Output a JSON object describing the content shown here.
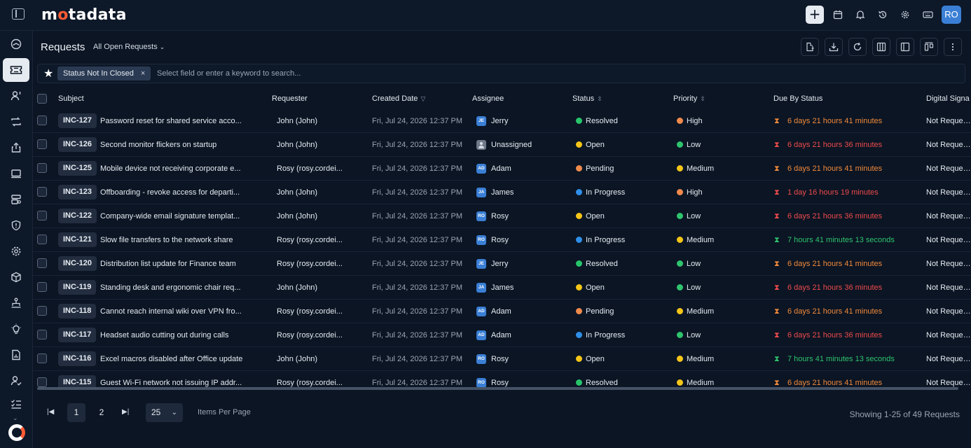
{
  "brand": {
    "logo_pre": "m",
    "logo_dot": "o",
    "logo_post": "tadata"
  },
  "topbar": {
    "avatar": "RO"
  },
  "header": {
    "title": "Requests",
    "view": "All Open Requests"
  },
  "filter": {
    "chip": "Status Not In Closed",
    "placeholder": "Select field or enter a keyword to search..."
  },
  "columns": {
    "subject": "Subject",
    "requester": "Requester",
    "created": "Created Date",
    "assignee": "Assignee",
    "status": "Status",
    "priority": "Priority",
    "due": "Due By Status",
    "signature": "Digital Signa"
  },
  "colors": {
    "resolved": "#27c46a",
    "open": "#f5c518",
    "pending": "#f08a4b",
    "in_progress": "#2f8fe8",
    "high": "#f08a4b",
    "low": "#2fc46d",
    "medium": "#f5c518",
    "due_orange": "#f28a3a",
    "due_red": "#ef4b4b",
    "due_green": "#2fc46d"
  },
  "rows": [
    {
      "id": "INC-127",
      "subject": "Password reset for shared service acco...",
      "requester": "John (John)",
      "created": "Fri, Jul 24, 2026 12:37 PM",
      "assignee_initials": "JE",
      "assignee": "Jerry",
      "status": "Resolved",
      "status_color": "#27c46a",
      "priority": "High",
      "priority_color": "#f08a4b",
      "due": "6 days 21 hours 41 minutes",
      "due_color": "#f28a3a",
      "signature": "Not Requeste"
    },
    {
      "id": "INC-126",
      "subject": "Second monitor flickers on startup",
      "requester": "John (John)",
      "created": "Fri, Jul 24, 2026 12:37 PM",
      "assignee_initials": "",
      "assignee": "Unassigned",
      "status": "Open",
      "status_color": "#f5c518",
      "priority": "Low",
      "priority_color": "#2fc46d",
      "due": "6 days 21 hours 36 minutes",
      "due_color": "#ef4b4b",
      "signature": "Not Requeste"
    },
    {
      "id": "INC-125",
      "subject": "Mobile device not receiving corporate e...",
      "requester": "Rosy (rosy.cordei...",
      "created": "Fri, Jul 24, 2026 12:37 PM",
      "assignee_initials": "AD",
      "assignee": "Adam",
      "status": "Pending",
      "status_color": "#f08a4b",
      "priority": "Medium",
      "priority_color": "#f5c518",
      "due": "6 days 21 hours 41 minutes",
      "due_color": "#f28a3a",
      "signature": "Not Requeste"
    },
    {
      "id": "INC-123",
      "subject": "Offboarding - revoke access for departi...",
      "requester": "John (John)",
      "created": "Fri, Jul 24, 2026 12:37 PM",
      "assignee_initials": "JA",
      "assignee": "James",
      "status": "In Progress",
      "status_color": "#2f8fe8",
      "priority": "High",
      "priority_color": "#f08a4b",
      "due": "1 day 16 hours 19 minutes",
      "due_color": "#ef4b4b",
      "signature": "Not Requeste"
    },
    {
      "id": "INC-122",
      "subject": "Company-wide email signature templat...",
      "requester": "John (John)",
      "created": "Fri, Jul 24, 2026 12:37 PM",
      "assignee_initials": "RO",
      "assignee": "Rosy",
      "status": "Open",
      "status_color": "#f5c518",
      "priority": "Low",
      "priority_color": "#2fc46d",
      "due": "6 days 21 hours 36 minutes",
      "due_color": "#ef4b4b",
      "signature": "Not Requeste"
    },
    {
      "id": "INC-121",
      "subject": "Slow file transfers to the network share",
      "requester": "Rosy (rosy.cordei...",
      "created": "Fri, Jul 24, 2026 12:37 PM",
      "assignee_initials": "RO",
      "assignee": "Rosy",
      "status": "In Progress",
      "status_color": "#2f8fe8",
      "priority": "Medium",
      "priority_color": "#f5c518",
      "due": "7 hours 41 minutes 13 seconds",
      "due_color": "#2fc46d",
      "signature": "Not Requeste"
    },
    {
      "id": "INC-120",
      "subject": "Distribution list update for Finance team",
      "requester": "Rosy (rosy.cordei...",
      "created": "Fri, Jul 24, 2026 12:37 PM",
      "assignee_initials": "JE",
      "assignee": "Jerry",
      "status": "Resolved",
      "status_color": "#27c46a",
      "priority": "Low",
      "priority_color": "#2fc46d",
      "due": "6 days 21 hours 41 minutes",
      "due_color": "#f28a3a",
      "signature": "Not Requeste"
    },
    {
      "id": "INC-119",
      "subject": "Standing desk and ergonomic chair req...",
      "requester": "John (John)",
      "created": "Fri, Jul 24, 2026 12:37 PM",
      "assignee_initials": "JA",
      "assignee": "James",
      "status": "Open",
      "status_color": "#f5c518",
      "priority": "Low",
      "priority_color": "#2fc46d",
      "due": "6 days 21 hours 36 minutes",
      "due_color": "#ef4b4b",
      "signature": "Not Requeste"
    },
    {
      "id": "INC-118",
      "subject": "Cannot reach internal wiki over VPN fro...",
      "requester": "Rosy (rosy.cordei...",
      "created": "Fri, Jul 24, 2026 12:37 PM",
      "assignee_initials": "AD",
      "assignee": "Adam",
      "status": "Pending",
      "status_color": "#f08a4b",
      "priority": "Medium",
      "priority_color": "#f5c518",
      "due": "6 days 21 hours 41 minutes",
      "due_color": "#f28a3a",
      "signature": "Not Requeste"
    },
    {
      "id": "INC-117",
      "subject": "Headset audio cutting out during calls",
      "requester": "Rosy (rosy.cordei...",
      "created": "Fri, Jul 24, 2026 12:37 PM",
      "assignee_initials": "AD",
      "assignee": "Adam",
      "status": "In Progress",
      "status_color": "#2f8fe8",
      "priority": "Low",
      "priority_color": "#2fc46d",
      "due": "6 days 21 hours 36 minutes",
      "due_color": "#ef4b4b",
      "signature": "Not Requeste"
    },
    {
      "id": "INC-116",
      "subject": "Excel macros disabled after Office update",
      "requester": "John (John)",
      "created": "Fri, Jul 24, 2026 12:37 PM",
      "assignee_initials": "RO",
      "assignee": "Rosy",
      "status": "Open",
      "status_color": "#f5c518",
      "priority": "Medium",
      "priority_color": "#f5c518",
      "due": "7 hours 41 minutes 13 seconds",
      "due_color": "#2fc46d",
      "signature": "Not Requeste"
    },
    {
      "id": "INC-115",
      "subject": "Guest Wi-Fi network not issuing IP addr...",
      "requester": "Rosy (rosy.cordei...",
      "created": "Fri, Jul 24, 2026 12:37 PM",
      "assignee_initials": "RO",
      "assignee": "Rosy",
      "status": "Resolved",
      "status_color": "#27c46a",
      "priority": "Medium",
      "priority_color": "#f5c518",
      "due": "6 days 21 hours 41 minutes",
      "due_color": "#f28a3a",
      "signature": "Not Requeste"
    }
  ],
  "pagination": {
    "pages": [
      "1",
      "2"
    ],
    "current": "1",
    "per_page": "25",
    "per_page_label": "Items Per Page",
    "showing": "Showing 1-25 of 49 Requests"
  },
  "sidebar": {
    "icons": [
      "dashboard-icon",
      "ticket-icon",
      "user-request-icon",
      "change-icon",
      "release-icon",
      "asset-icon",
      "cmdb-icon",
      "security-icon",
      "settings-cog-icon",
      "package-icon",
      "hierarchy-icon",
      "idea-icon",
      "report-icon",
      "user-check-icon",
      "checklist-icon"
    ]
  }
}
